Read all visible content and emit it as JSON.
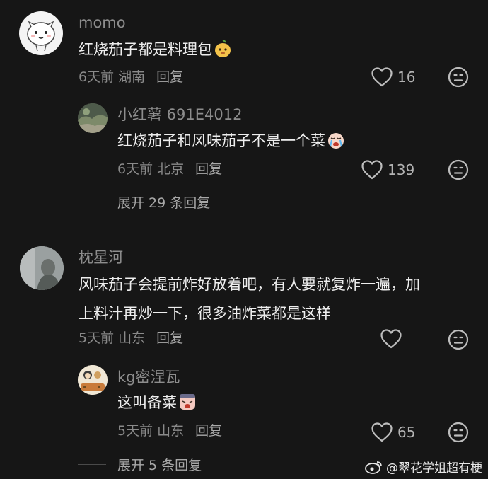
{
  "comments": [
    {
      "username": "momo",
      "text": "红烧茄子都是料理包",
      "date_location": "6天前 湖南",
      "reply_label": "回复",
      "likes": "16",
      "emoji": "pear-face-emoji",
      "replies": [
        {
          "username": "小红薯 691E4012",
          "text": "红烧茄子和风味茄子不是一个菜",
          "date_location": "6天前 北京",
          "reply_label": "回复",
          "likes": "139",
          "emoji": "crying-face-emoji"
        }
      ],
      "expand_label": "展开 29 条回复"
    },
    {
      "username": "枕星河",
      "text_line1": "风味茄子会提前炸好放着吧，有人要就复炸一遍，加",
      "text_line2": "上料汁再炒一下，很多油炸菜都是这样",
      "date_location": "5天前 山东",
      "reply_label": "回复",
      "likes": "",
      "replies": [
        {
          "username": "kg密涅瓦",
          "text": "这叫备菜",
          "date_location": "5天前 山东",
          "reply_label": "回复",
          "likes": "65",
          "emoji": "tired-face-emoji"
        }
      ],
      "expand_label": "展开 5 条回复"
    }
  ],
  "watermark": "@翠花学姐超有梗",
  "colors": {
    "background": "#161616",
    "username": "#8d8d8d",
    "text": "#eeeeee",
    "meta": "#8a8a8a"
  }
}
